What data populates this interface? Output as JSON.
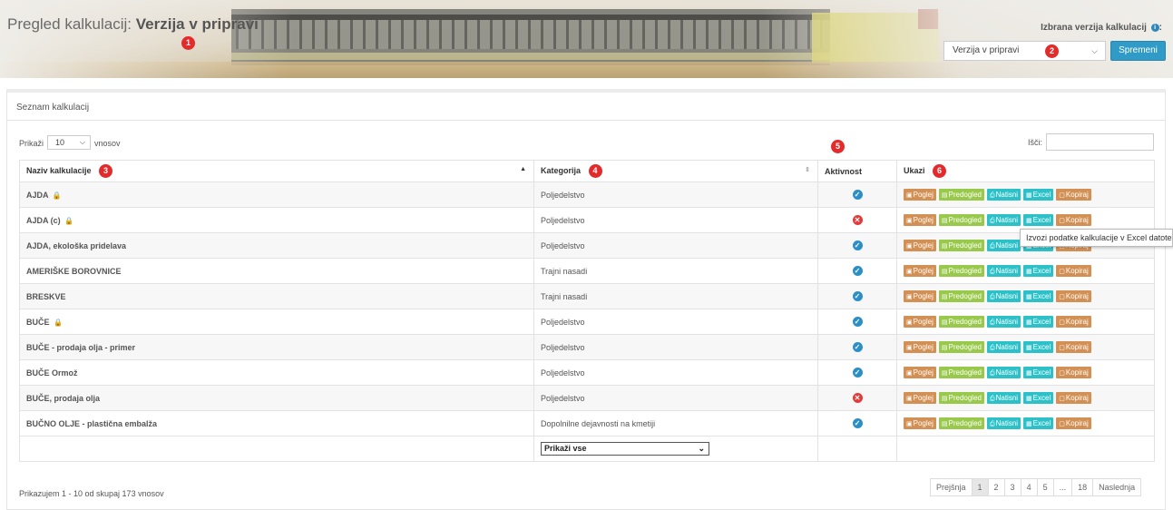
{
  "header": {
    "title_prefix": "Pregled kalkulacij:",
    "title_bold": "Verzija v pripravi",
    "version_label": "Izbrana verzija kalkulacij",
    "version_label_suffix": ":",
    "version_selected": "Verzija v pripravi",
    "change_button": "Spremeni"
  },
  "badges": [
    "1",
    "2",
    "3",
    "4",
    "5",
    "6"
  ],
  "panel": {
    "title": "Seznam kalkulacij",
    "show_label": "Prikaži",
    "page_length": "10",
    "entries_label": "vnosov",
    "search_label": "Išči:"
  },
  "table": {
    "columns": [
      "Naziv kalkulacije",
      "Kategorija",
      "Aktivnost",
      "Ukazi"
    ],
    "actions": [
      "Poglej",
      "Predogled",
      "Natisni",
      "Excel",
      "Kopiraj"
    ],
    "rows": [
      {
        "name": "AJDA",
        "locked": true,
        "category": "Poljedelstvo",
        "active": true
      },
      {
        "name": "AJDA (c)",
        "locked": true,
        "category": "Poljedelstvo",
        "active": false
      },
      {
        "name": "AJDA, ekološka pridelava",
        "locked": false,
        "category": "Poljedelstvo",
        "active": true
      },
      {
        "name": "AMERIŠKE BOROVNICE",
        "locked": false,
        "category": "Trajni nasadi",
        "active": true
      },
      {
        "name": "BRESKVE",
        "locked": false,
        "category": "Trajni nasadi",
        "active": true
      },
      {
        "name": "BUČE",
        "locked": true,
        "category": "Poljedelstvo",
        "active": true
      },
      {
        "name": "BUČE - prodaja olja - primer",
        "locked": false,
        "category": "Poljedelstvo",
        "active": true
      },
      {
        "name": "BUČE Ormož",
        "locked": false,
        "category": "Poljedelstvo",
        "active": true
      },
      {
        "name": "BUČE, prodaja olja",
        "locked": false,
        "category": "Poljedelstvo",
        "active": false
      },
      {
        "name": "BUČNO OLJE - plastična embalža",
        "locked": false,
        "category": "Dopolnilne dejavnosti na kmetiji",
        "active": true
      }
    ],
    "category_filter": "Prikaži vse"
  },
  "tooltip": "Izvozi podatke kalkulacije v Excel datoteko",
  "footer": {
    "info": "Prikazujem 1 - 10 od skupaj 173 vnosov",
    "pager": [
      "Prejšnja",
      "1",
      "2",
      "3",
      "4",
      "5",
      "...",
      "18",
      "Naslednja"
    ],
    "active_page": "1"
  },
  "colors": {
    "primary": "#2f9bc6",
    "badge": "#e32b2b",
    "btn_view": "#d39054",
    "btn_preview": "#99c94b",
    "btn_print": "#2cc1c9",
    "status_ok": "#2b8fc6",
    "status_inactive": "#e23b3b"
  }
}
